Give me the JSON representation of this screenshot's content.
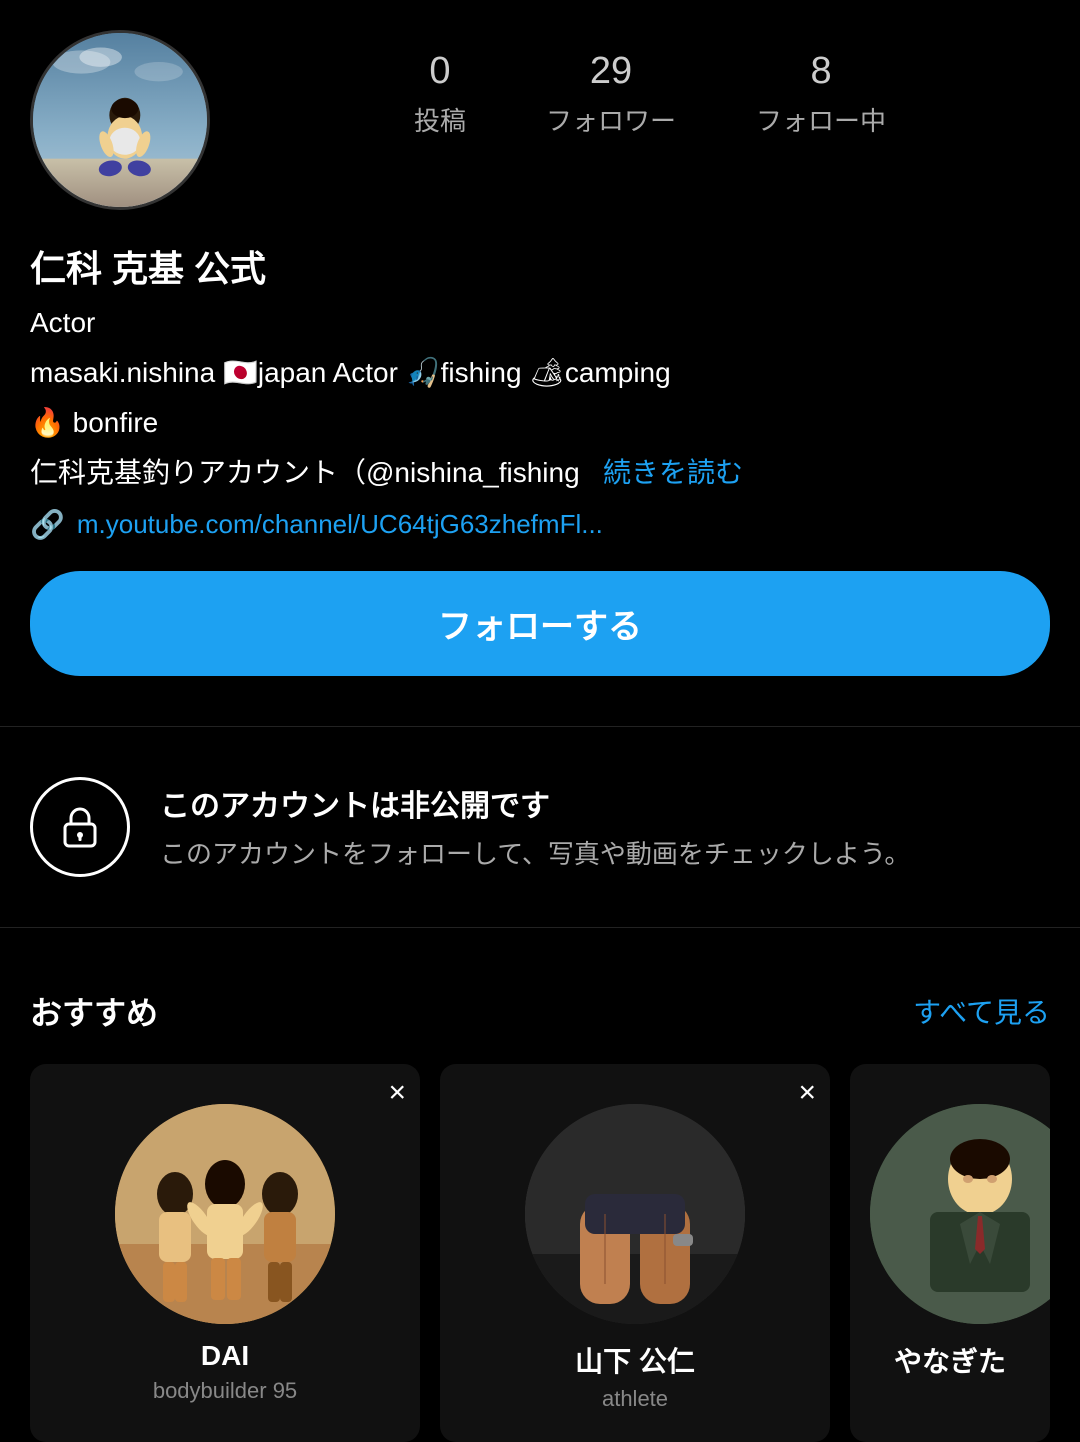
{
  "profile": {
    "display_name": "仁科 克基 公式",
    "role": "Actor",
    "bio_line": "masaki.nishina 🇯🇵japan  Actor  🎣fishing  🏕camping",
    "bio_line2": "🔥 bonfire",
    "bio_line3": "仁科克基釣りアカウント（@nishina_fishing",
    "bio_line3_link": "続きを読む",
    "link_text": "m.youtube.com/channel/UC64tjG63zhefmFl...",
    "stats": {
      "posts_count": "0",
      "posts_label": "投稿",
      "followers_count": "29",
      "followers_label": "フォロワー",
      "following_count": "8",
      "following_label": "フォロー中"
    },
    "follow_button_label": "フォローする"
  },
  "private_notice": {
    "title": "このアカウントは非公開です",
    "description": "このアカウントをフォローして、写真や動画をチェックしよう。"
  },
  "recommended": {
    "section_title": "おすすめ",
    "see_all_label": "すべて見る",
    "cards": [
      {
        "name": "DAI",
        "sub": "bodybuilder 95"
      },
      {
        "name": "山下 公仁",
        "sub": "athlete"
      },
      {
        "name": "やなぎた",
        "sub": ""
      }
    ]
  }
}
